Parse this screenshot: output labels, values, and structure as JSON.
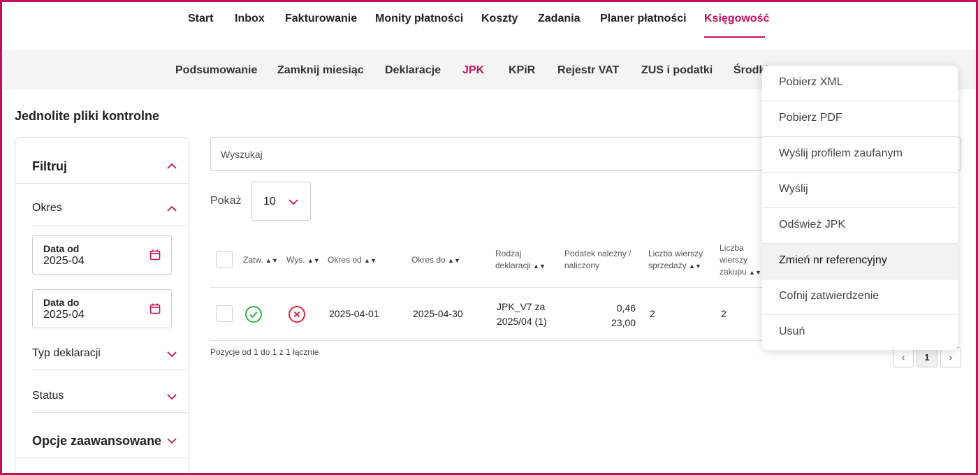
{
  "top_nav": {
    "items": [
      "Start",
      "Inbox",
      "Fakturowanie",
      "Monity płatności",
      "Koszty",
      "Zadania",
      "Planer płatności",
      "Księgowość"
    ],
    "active": "Księgowość"
  },
  "sub_nav": {
    "items": [
      "Podsumowanie",
      "Zamknij miesiąc",
      "Deklaracje",
      "JPK",
      "KPiR",
      "Rejestr VAT",
      "ZUS i podatki",
      "Środki"
    ],
    "active": "JPK"
  },
  "page_title": "Jednolite pliki kontrolne",
  "filters": {
    "title": "Filtruj",
    "period": "Okres",
    "date_from_label": "Data od",
    "date_from_value": "2025-04",
    "date_to_label": "Data do",
    "date_to_value": "2025-04",
    "declaration_type": "Typ deklaracji",
    "status": "Status",
    "advanced": "Opcje zaawansowane"
  },
  "search": {
    "placeholder": "Wyszukaj"
  },
  "page_size": {
    "label": "Pokaż",
    "value": "10"
  },
  "table": {
    "headers": {
      "approved": "Zatw.",
      "sent": "Wys.",
      "period_from": "Okres od",
      "period_to": "Okres do",
      "decl_type_1": "Rodzaj",
      "decl_type_2": "deklaracji",
      "tax_1": "Podatek należny /",
      "tax_2": "naliczony",
      "sales_1": "Liczba wierszy",
      "sales_2": "sprzedaży",
      "purchase_1": "Liczba",
      "purchase_2": "wierszy",
      "purchase_3": "zakupu"
    },
    "rows": [
      {
        "approved": true,
        "sent": false,
        "period_from": "2025-04-01",
        "period_to": "2025-04-30",
        "decl_type_1": "JPK_V7 za",
        "decl_type_2": "2025/04 (1)",
        "tax_due": "0,46",
        "tax_input": "23,00",
        "sales_rows": "2",
        "purchase_rows": "2"
      }
    ]
  },
  "positions_label": "Pozycje od 1 do 1 z 1 łącznie",
  "pagination": {
    "prev": "‹",
    "current": "1",
    "next": "›"
  },
  "menu": {
    "items": [
      "Pobierz XML",
      "Pobierz PDF",
      "Wyślij profilem zaufanym",
      "Wyślij",
      "Odśwież JPK",
      "Zmień nr referencyjny",
      "Cofnij zatwierdzenie",
      "Usuń"
    ],
    "hovered_index": 5
  },
  "colors": {
    "accent": "#c0115c",
    "success": "#2fb344",
    "danger": "#d9263d"
  }
}
